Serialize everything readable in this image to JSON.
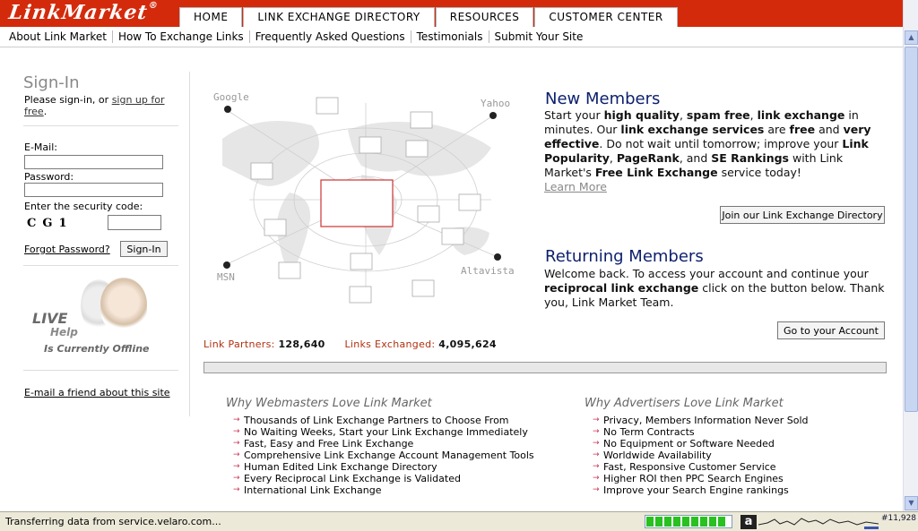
{
  "header": {
    "logo": "LinkMarket",
    "logo_mark": "®",
    "tabs": [
      {
        "label": "HOME"
      },
      {
        "label": "LINK EXCHANGE DIRECTORY"
      },
      {
        "label": "RESOURCES"
      },
      {
        "label": "CUSTOMER CENTER"
      }
    ]
  },
  "subnav": [
    {
      "label": "About Link Market"
    },
    {
      "label": "How To Exchange Links"
    },
    {
      "label": "Frequently Asked Questions"
    },
    {
      "label": "Testimonials"
    },
    {
      "label": "Submit Your Site"
    }
  ],
  "sidebar": {
    "title": "Sign-In",
    "intro_before": "Please sign-in, or ",
    "intro_link": "sign up for free",
    "intro_after": ".",
    "email_label": "E-Mail:",
    "password_label": "Password:",
    "security_label": "Enter the security code:",
    "captcha": "CG1",
    "forgot": "Forgot Password?",
    "signin_button": "Sign-In",
    "live": "LIVE",
    "help": "Help",
    "offline": "Is Currently Offline",
    "email_friend": "E-mail a friend about this site"
  },
  "map": {
    "engines": [
      "Google",
      "Yahoo",
      "MSN",
      "Altavista"
    ]
  },
  "stats": {
    "partners_label": "Link Partners:",
    "partners_value": "128,640",
    "exchanged_label": "Links Exchanged:",
    "exchanged_value": "4,095,624"
  },
  "new_members": {
    "title": "New Members",
    "learn_more": "Learn More",
    "button": "Join our Link Exchange Directory"
  },
  "returning_members": {
    "title": "Returning Members",
    "button": "Go to your Account"
  },
  "webmasters": {
    "title": "Why Webmasters Love Link Market",
    "items": [
      "Thousands of Link Exchange Partners to Choose From",
      "No Waiting Weeks, Start your Link Exchange Immediately",
      "Fast, Easy and Free Link Exchange",
      "Comprehensive Link Exchange Account Management Tools",
      "Human Edited Link Exchange Directory",
      "Every Reciprocal Link Exchange is Validated",
      "International Link Exchange"
    ]
  },
  "advertisers": {
    "title": "Why Advertisers Love Link Market",
    "items": [
      "Privacy, Members Information Never Sold",
      "No Term Contracts",
      "No Equipment or Software Needed",
      "Worldwide Availability",
      "Fast, Responsive Customer Service",
      "Higher ROI then PPC Search Engines",
      "Improve your Search Engine rankings"
    ]
  },
  "statusbar": {
    "text": "Transferring data from service.velaro.com...",
    "alexa_letter": "a",
    "rank": "#11,928"
  },
  "colors": {
    "brand_red": "#d32a0c",
    "title_navy": "#0c1f6d",
    "progress_green": "#28c11f"
  }
}
